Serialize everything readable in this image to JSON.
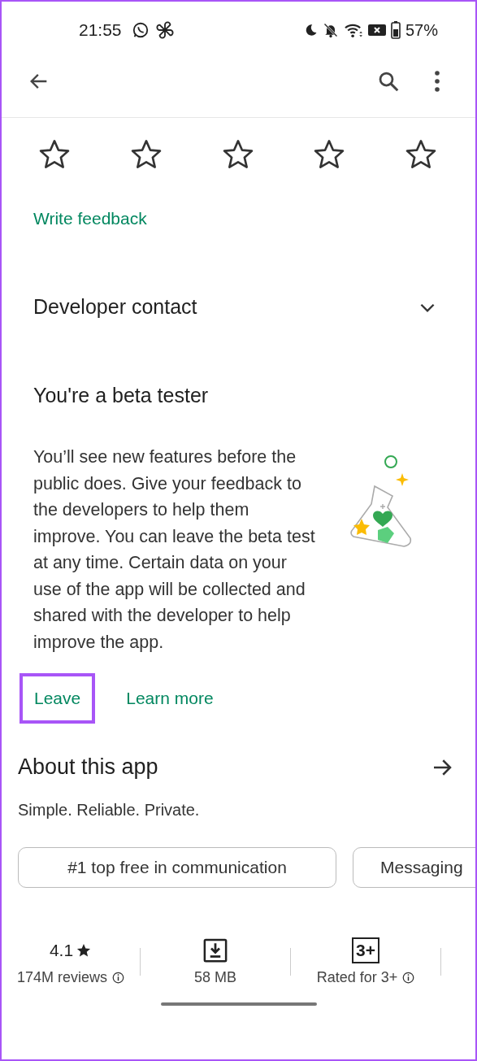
{
  "status_bar": {
    "time": "21:55",
    "battery": "57%"
  },
  "rating": {
    "stars": 0
  },
  "write_feedback": "Write feedback",
  "developer_contact": {
    "title": "Developer contact",
    "expanded": false
  },
  "beta": {
    "title": "You're a beta tester",
    "text": "You’ll see new features before the public does. Give your feedback to the developers to help them improve. You can leave the beta test at any time. Certain data on your use of the app will be collected and shared with the developer to help improve the app.",
    "actions": [
      {
        "label": "Leave",
        "highlighted": true
      },
      {
        "label": "Learn more",
        "highlighted": false
      }
    ]
  },
  "about": {
    "title": "About this app",
    "tagline": "Simple. Reliable. Private."
  },
  "chips": [
    {
      "label": "#1 top free in communication"
    },
    {
      "label": "Messaging"
    }
  ],
  "stats": [
    {
      "kind": "rating",
      "value": "4.1",
      "label": "174M reviews",
      "info": true
    },
    {
      "kind": "size",
      "label": "58 MB",
      "info": false
    },
    {
      "kind": "age",
      "badge": "3+",
      "label": "Rated for 3+",
      "info": true
    }
  ]
}
